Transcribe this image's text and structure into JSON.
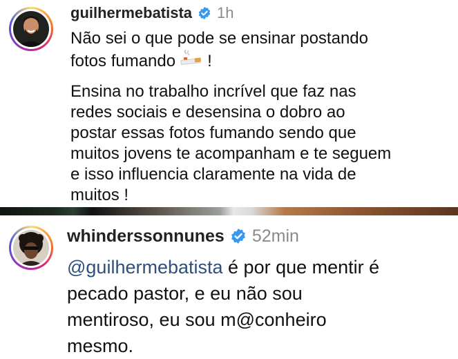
{
  "comment1": {
    "username": "guilhermebatista",
    "time": "1h",
    "paragraph1": {
      "line1": "Não sei o que pode se ensinar postando",
      "line2_before": "fotos fumando",
      "emoji": "smoking-emoji",
      "line2_after": "!"
    },
    "paragraph2_lines": [
      "Ensina no trabalho incrível que faz nas",
      "redes sociais e desensina o dobro ao",
      "postar essas fotos fumando sendo que",
      "muitos jovens te acompanham e te seguem",
      "e isso influencia claramente na vida de",
      "muitos !"
    ]
  },
  "comment2": {
    "username": "whinderssonnunes",
    "time": "52min",
    "mention": "@guilhermebatista",
    "line1_rest": " é por que mentir é",
    "lines": [
      "pecado pastor, e eu não sou",
      "mentiroso, eu sou m@conheiro",
      "mesmo."
    ]
  },
  "colors": {
    "verified_blue": "#3897f0",
    "mention": "#2f4f7a",
    "timestamp": "#8a8a8a"
  },
  "icons": [
    "verified-badge-icon",
    "smoking-emoji-icon"
  ]
}
